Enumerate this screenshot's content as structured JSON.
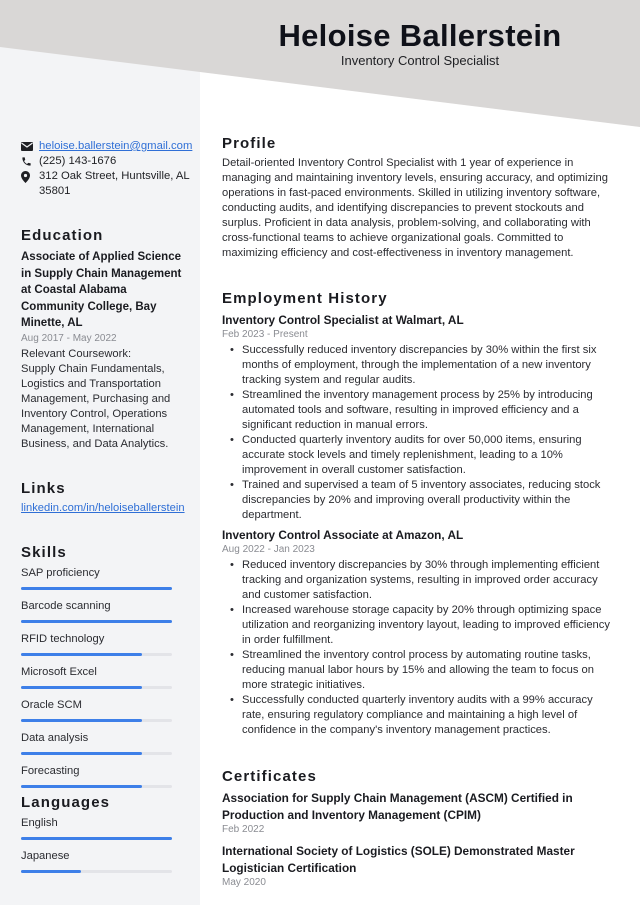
{
  "header": {
    "name": "Heloise Ballerstein",
    "title": "Inventory Control Specialist"
  },
  "contact": {
    "email": "heloise.ballerstein@gmail.com",
    "phone": "(225) 143-1676",
    "address": "312 Oak Street, Huntsville, AL 35801",
    "icons": [
      "envelope-icon",
      "phone-icon",
      "map-pin-icon"
    ]
  },
  "education": {
    "heading": "Education",
    "degree": "Associate of Applied Science in Supply Chain Management at Coastal Alabama Community College, Bay Minette, AL",
    "dates": "Aug 2017 - May 2022",
    "coursework_label": "Relevant Coursework:",
    "coursework": "Supply Chain Fundamentals, Logistics and Transportation Management, Purchasing and Inventory Control, Operations Management, International Business, and Data Analytics."
  },
  "links": {
    "heading": "Links",
    "items": [
      "linkedin.com/in/heloiseballerstein"
    ]
  },
  "skills": {
    "heading": "Skills",
    "items": [
      {
        "label": "SAP proficiency",
        "level": 1.0
      },
      {
        "label": "Barcode scanning",
        "level": 1.0
      },
      {
        "label": "RFID technology",
        "level": 0.8
      },
      {
        "label": "Microsoft Excel",
        "level": 0.8
      },
      {
        "label": "Oracle SCM",
        "level": 0.8
      },
      {
        "label": "Data analysis",
        "level": 0.8
      },
      {
        "label": "Forecasting",
        "level": 0.8
      }
    ]
  },
  "languages": {
    "heading": "Languages",
    "items": [
      {
        "label": "English",
        "level": 1.0
      },
      {
        "label": "Japanese",
        "level": 0.4
      }
    ]
  },
  "profile": {
    "heading": "Profile",
    "text": "Detail-oriented Inventory Control Specialist with 1 year of experience in managing and maintaining inventory levels, ensuring accuracy, and optimizing operations in fast-paced environments. Skilled in utilizing inventory software, conducting audits, and identifying discrepancies to prevent stockouts and surplus. Proficient in data analysis, problem-solving, and collaborating with cross-functional teams to achieve organizational goals. Committed to maximizing efficiency and cost-effectiveness in inventory management."
  },
  "employment": {
    "heading": "Employment History",
    "jobs": [
      {
        "title": "Inventory Control Specialist at Walmart, AL",
        "dates": "Feb 2023 - Present",
        "bullets": [
          "Successfully reduced inventory discrepancies by 30% within the first six months of employment, through the implementation of a new inventory tracking system and regular audits.",
          "Streamlined the inventory management process by 25% by introducing automated tools and software, resulting in improved efficiency and a significant reduction in manual errors.",
          "Conducted quarterly inventory audits for over 50,000 items, ensuring accurate stock levels and timely replenishment, leading to a 10% improvement in overall customer satisfaction.",
          "Trained and supervised a team of 5 inventory associates, reducing stock discrepancies by 20% and improving overall productivity within the department."
        ]
      },
      {
        "title": "Inventory Control Associate at Amazon, AL",
        "dates": "Aug 2022 - Jan 2023",
        "bullets": [
          "Reduced inventory discrepancies by 30% through implementing efficient tracking and organization systems, resulting in improved order accuracy and customer satisfaction.",
          "Increased warehouse storage capacity by 20% through optimizing space utilization and reorganizing inventory layout, leading to improved efficiency in order fulfillment.",
          "Streamlined the inventory control process by automating routine tasks, reducing manual labor hours by 15% and allowing the team to focus on more strategic initiatives.",
          "Successfully conducted quarterly inventory audits with a 99% accuracy rate, ensuring regulatory compliance and maintaining a high level of confidence in the company's inventory management practices."
        ]
      }
    ]
  },
  "certificates": {
    "heading": "Certificates",
    "items": [
      {
        "title": "Association for Supply Chain Management (ASCM) Certified in Production and Inventory Management (CPIM)",
        "date": "Feb 2022"
      },
      {
        "title": "International Society of Logistics (SOLE) Demonstrated Master Logistician Certification",
        "date": "May 2020"
      }
    ]
  },
  "colors": {
    "header_band": "#d9d7d6",
    "sidebar": "#f3f4f6",
    "accent": "#3d7fe8",
    "link": "#2f6fd6"
  }
}
